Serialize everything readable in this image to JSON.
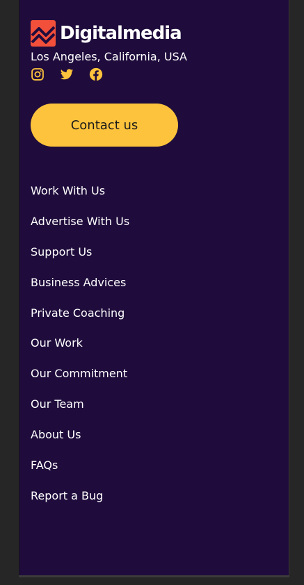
{
  "brand": {
    "name": "Digitalmedia",
    "accent": "#fdc33c",
    "logo_color": "#f2503b",
    "panel_bg": "#1f0c3c"
  },
  "location": "Los Angeles, California, USA",
  "socials": [
    {
      "icon": "instagram-icon"
    },
    {
      "icon": "twitter-icon"
    },
    {
      "icon": "facebook-icon"
    }
  ],
  "cta": {
    "label": "Contact us"
  },
  "links": [
    "Work With Us",
    "Advertise With Us",
    "Support Us",
    "Business Advices",
    "Private Coaching",
    "Our Work",
    "Our Commitment",
    "Our Team",
    "About Us",
    "FAQs",
    "Report a Bug"
  ]
}
